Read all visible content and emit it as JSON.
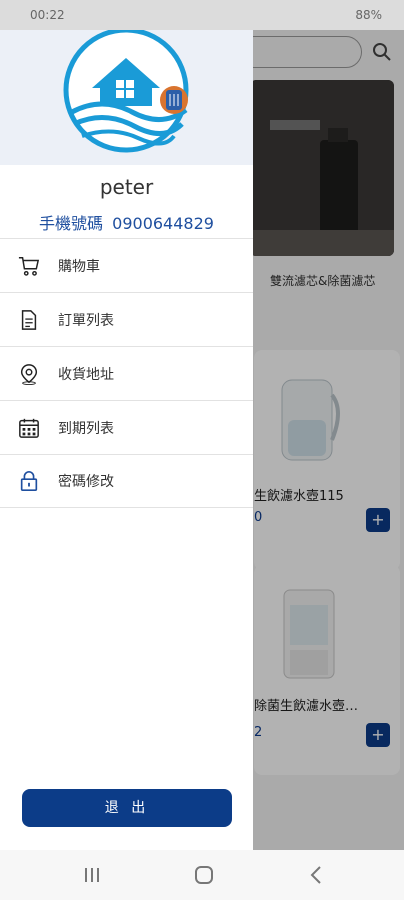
{
  "status_bar": {
    "time": "00:22",
    "battery": "88%"
  },
  "background": {
    "banner_caption": "雙流濾芯&除菌濾芯",
    "products": [
      {
        "title": "生飲濾水壺115",
        "price": "0",
        "add": "+"
      },
      {
        "title": "除菌生飲濾水壺…",
        "price": "2",
        "add": "+"
      }
    ]
  },
  "drawer": {
    "username": "peter",
    "phone_label": "手機號碼",
    "phone_number": "0900644829",
    "menu": [
      {
        "label": "購物車",
        "icon": "cart-icon"
      },
      {
        "label": "訂單列表",
        "icon": "document-icon"
      },
      {
        "label": "收貨地址",
        "icon": "location-pin-icon"
      },
      {
        "label": "到期列表",
        "icon": "calendar-icon"
      },
      {
        "label": "密碼修改",
        "icon": "lock-icon"
      }
    ],
    "logout_label": "退 出"
  },
  "colors": {
    "accent": "#0c3c88",
    "phone_text": "#1f4f9f",
    "logo_blue": "#1a9bd7"
  }
}
